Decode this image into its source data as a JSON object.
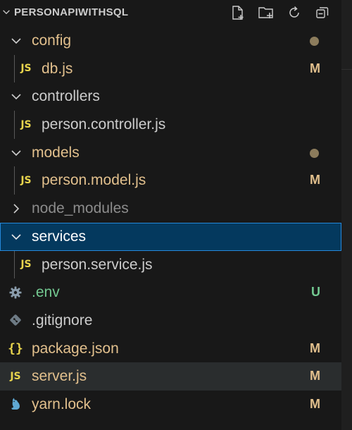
{
  "explorer": {
    "title": "PERSONAPIWITHSQL",
    "actions": [
      {
        "name": "new-file-icon"
      },
      {
        "name": "new-folder-icon"
      },
      {
        "name": "refresh-icon"
      },
      {
        "name": "collapse-all-icon"
      }
    ]
  },
  "tree": {
    "config": {
      "label": "config"
    },
    "db": {
      "label": "db.js",
      "status": "M"
    },
    "controllers": {
      "label": "controllers"
    },
    "person_controller": {
      "label": "person.controller.js"
    },
    "models": {
      "label": "models"
    },
    "person_model": {
      "label": "person.model.js",
      "status": "M"
    },
    "node_modules": {
      "label": "node_modules"
    },
    "services": {
      "label": "services"
    },
    "person_service": {
      "label": "person.service.js"
    },
    "env": {
      "label": ".env",
      "status": "U"
    },
    "gitignore": {
      "label": ".gitignore"
    },
    "package_json": {
      "label": "package.json",
      "status": "M"
    },
    "server": {
      "label": "server.js",
      "status": "M"
    },
    "yarn_lock": {
      "label": "yarn.lock",
      "status": "M"
    }
  },
  "colors": {
    "modified": "#e2c08d",
    "untracked": "#73c991",
    "default_text": "#cccccc",
    "ignored": "#8c8c8c",
    "selection": "#04395e",
    "js_icon": "#e8d44d"
  },
  "icons": {
    "js": "JS",
    "json": "{}"
  }
}
